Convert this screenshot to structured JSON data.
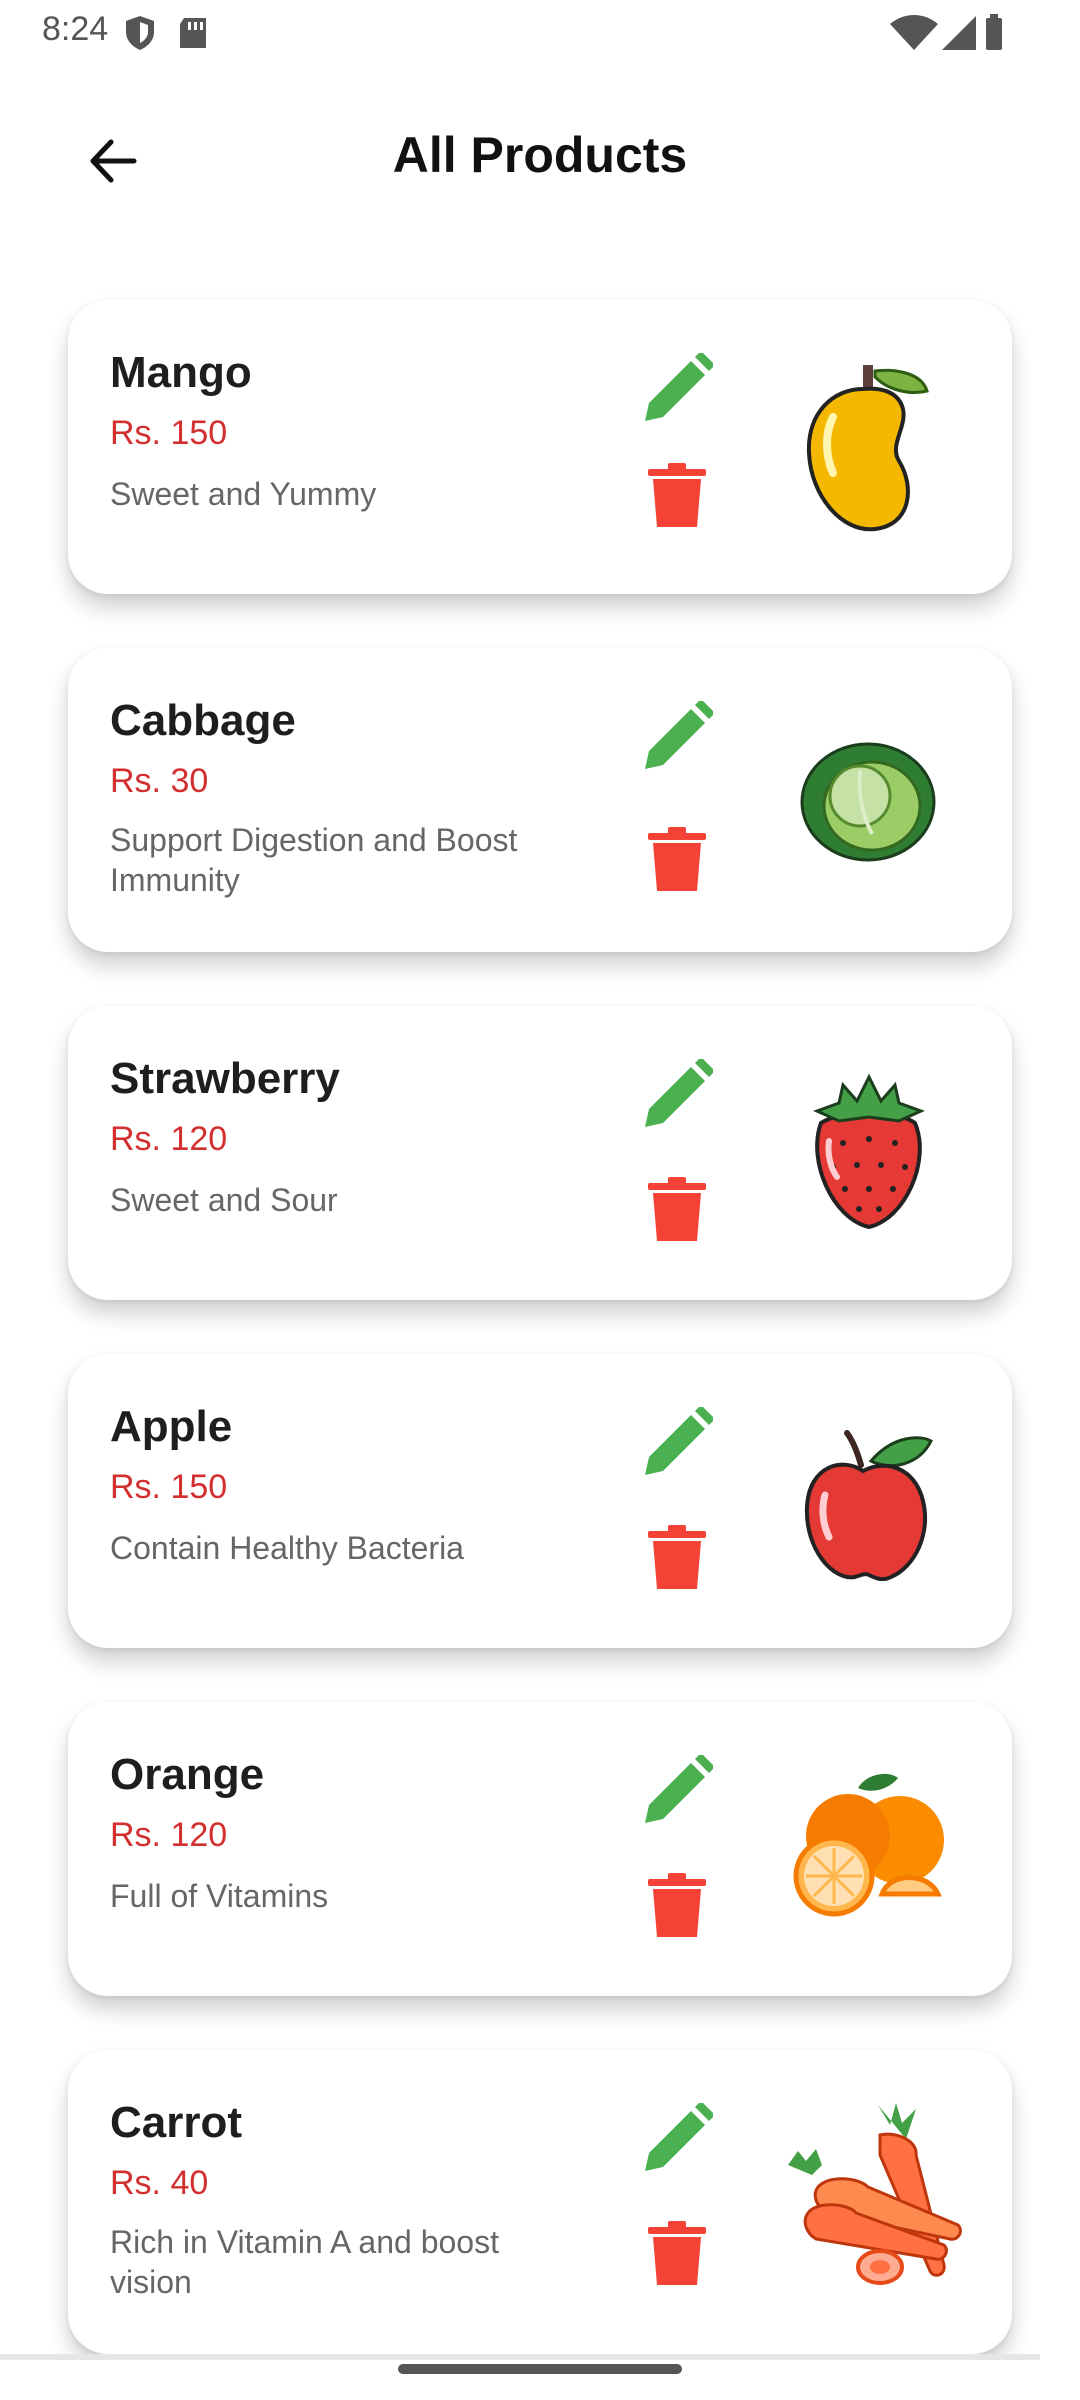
{
  "status_bar": {
    "time": "8:24",
    "icons": [
      "shield-icon",
      "sd-card-icon",
      "wifi-icon",
      "signal-icon",
      "battery-icon"
    ]
  },
  "app_bar": {
    "title": "All Products",
    "back_icon": "arrow-back-icon"
  },
  "colors": {
    "price": "#d32f2f",
    "edit": "#4caf50",
    "delete": "#f44336"
  },
  "products": [
    {
      "name": "Mango",
      "price": "Rs. 150",
      "description": "Sweet and Yummy",
      "image": "mango-image"
    },
    {
      "name": "Cabbage",
      "price": "Rs. 30",
      "description": "Support Digestion and Boost Immunity",
      "image": "cabbage-image"
    },
    {
      "name": "Strawberry",
      "price": "Rs. 120",
      "description": "Sweet and Sour",
      "image": "strawberry-image"
    },
    {
      "name": "Apple",
      "price": "Rs. 150",
      "description": "Contain Healthy Bacteria",
      "image": "apple-image"
    },
    {
      "name": "Orange",
      "price": "Rs. 120",
      "description": "Full of Vitamins",
      "image": "orange-image"
    },
    {
      "name": "Carrot",
      "price": "Rs. 40",
      "description": "Rich in Vitamin A and boost vision",
      "image": "carrot-image"
    }
  ]
}
